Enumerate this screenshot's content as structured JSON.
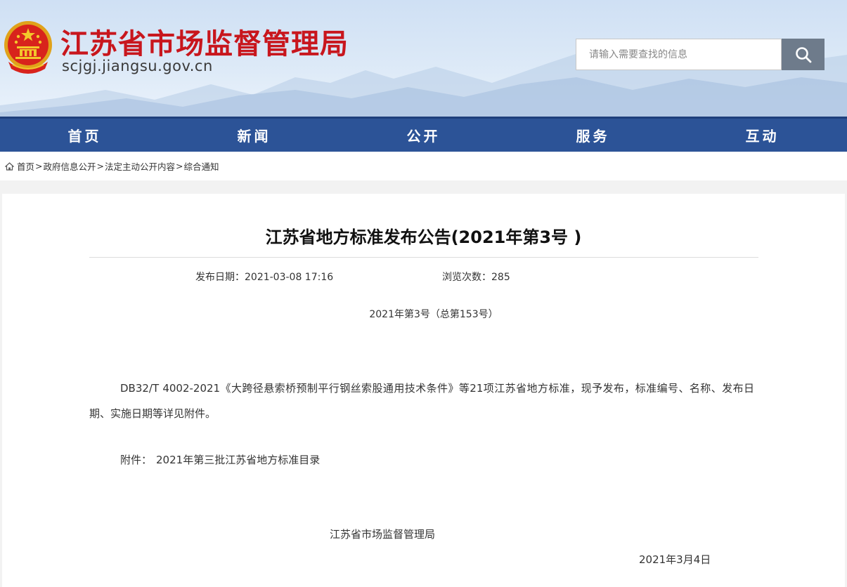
{
  "header": {
    "site_title": "江苏省市场监督管理局",
    "site_url": "scjgj.jiangsu.gov.cn",
    "search_placeholder": "请输入需要查找的信息",
    "title_color": "#c8161d"
  },
  "nav": {
    "items": [
      "首页",
      "新闻",
      "公开",
      "服务",
      "互动"
    ],
    "background": "#2c5397"
  },
  "breadcrumb": {
    "items": [
      "首页",
      "政府信息公开",
      "法定主动公开内容",
      "综合通知"
    ],
    "separator": ">"
  },
  "article": {
    "title": "江苏省地方标准发布公告(2021年第3号 )",
    "publish_label": "发布日期：2021-03-08 17:16",
    "views_label": "浏览次数：285",
    "issue_number": "2021年第3号（总第153号）",
    "body": "DB32/T 4002-2021《大跨径悬索桥预制平行钢丝索股通用技术条件》等21项江苏省地方标准，现予发布，标准编号、名称、发布日期、实施日期等详见附件。",
    "attachment_label": "附件：",
    "attachment_name": "2021年第三批江苏省地方标准目录",
    "signature": "江苏省市场监督管理局",
    "date": "2021年3月4日"
  }
}
